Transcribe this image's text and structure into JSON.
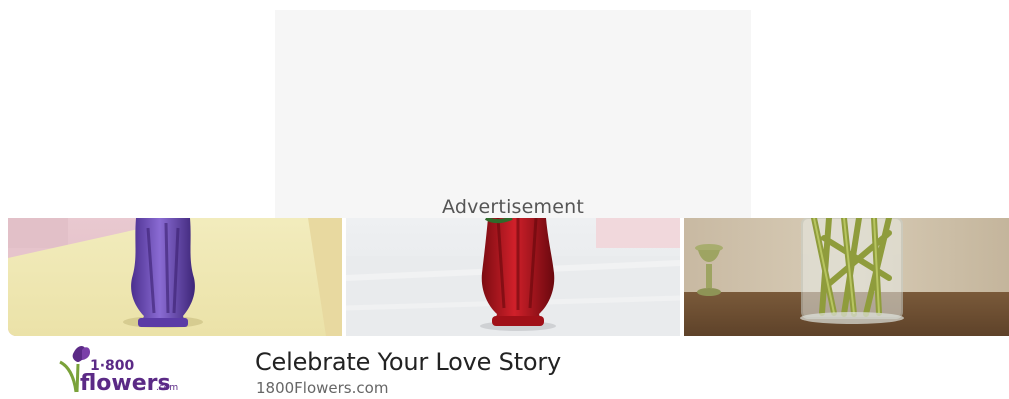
{
  "ad": {
    "label": "Advertisement"
  },
  "images": [
    {
      "name": "purple-vase-photo",
      "description_color": "#6b4fb0"
    },
    {
      "name": "red-vase-photo",
      "description_color": "#b0141c"
    },
    {
      "name": "green-stems-vase-photo",
      "description_color": "#9aa553"
    }
  ],
  "promo": {
    "headline": "Celebrate Your Love Story",
    "source": "1800Flowers.com",
    "logo": {
      "top_text": "1·800",
      "main_text": "flowers",
      "suffix": ".com",
      "brand_color": "#5b2a86",
      "leaf_color": "#7aa23a"
    }
  }
}
